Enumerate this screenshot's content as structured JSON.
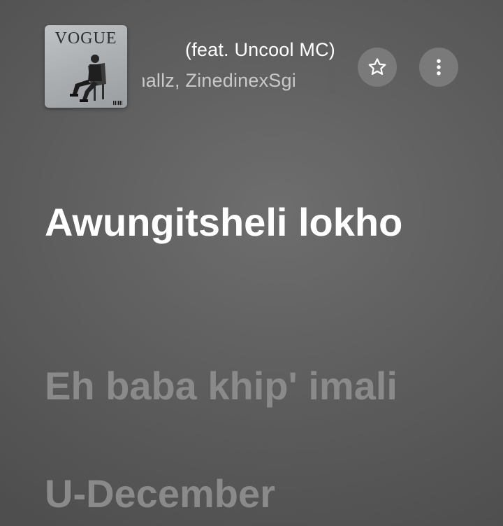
{
  "now_playing": {
    "album_art_logo": "VOGUE",
    "track_title": "(feat. Uncool MC)",
    "track_artist": "mallz, ZinedinexSgi"
  },
  "actions": {
    "favorite_icon": "star-outline-icon",
    "more_icon": "more-vertical-icon"
  },
  "lyrics": {
    "lines": [
      {
        "text": "Awungitsheli lokho",
        "state": "active"
      },
      {
        "text": "Eh baba khip' imali",
        "state": "upcoming"
      },
      {
        "text": "U-December",
        "state": "upcoming"
      }
    ]
  },
  "colors": {
    "background": "#636363",
    "active_lyric": "#ffffff",
    "upcoming_lyric": "#8a8a8a",
    "button_bg": "#7a7a7a",
    "artist_text": "#c9c9c9"
  }
}
